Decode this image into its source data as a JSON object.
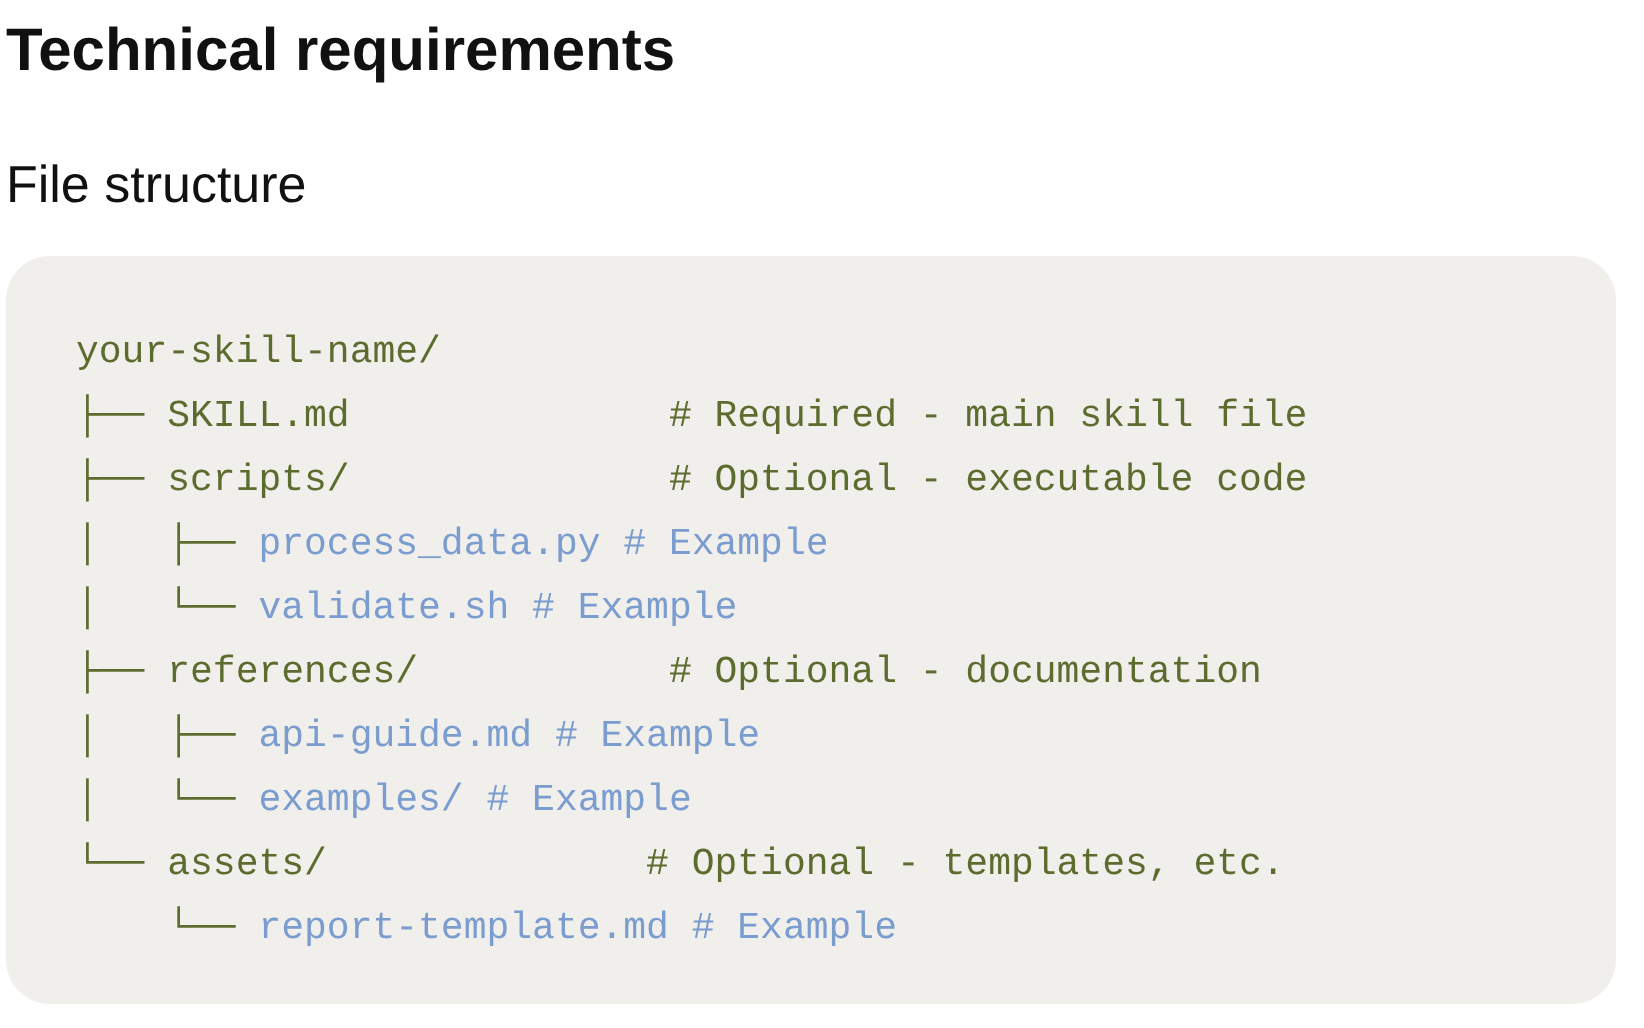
{
  "heading": "Technical requirements",
  "subheading": "File structure",
  "code_block": {
    "lines": [
      {
        "kind": "dir",
        "text": "your-skill-name/"
      },
      {
        "kind": "dir",
        "tree": "├── ",
        "text": "SKILL.md              # Required - main skill file"
      },
      {
        "kind": "dir",
        "tree": "├── ",
        "text": "scripts/              # Optional - executable code"
      },
      {
        "kind": "example",
        "tree": "│   ├── ",
        "text": "process_data.py # Example"
      },
      {
        "kind": "example",
        "tree": "│   └── ",
        "text": "validate.sh # Example"
      },
      {
        "kind": "dir",
        "tree": "├── ",
        "text": "references/           # Optional - documentation"
      },
      {
        "kind": "example",
        "tree": "│   ├── ",
        "text": "api-guide.md # Example"
      },
      {
        "kind": "example",
        "tree": "│   └── ",
        "text": "examples/ # Example"
      },
      {
        "kind": "dir",
        "tree": "└── ",
        "text": "assets/              # Optional - templates, etc."
      },
      {
        "kind": "example",
        "tree": "    └── ",
        "text": "report-template.md # Example"
      }
    ]
  }
}
